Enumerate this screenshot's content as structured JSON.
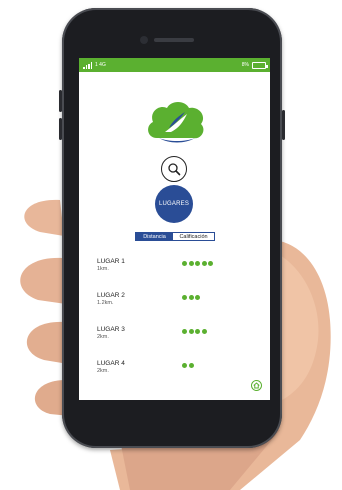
{
  "status_bar": {
    "network": "1 4G",
    "battery": "8%"
  },
  "home": {
    "places_button_label": "LUGARES"
  },
  "tabs": [
    {
      "label": "Distancia",
      "active": true
    },
    {
      "label": "Calificación",
      "active": false
    }
  ],
  "places": [
    {
      "name": "LUGAR 1",
      "distance": "1km.",
      "rating": 5
    },
    {
      "name": "LUGAR 2",
      "distance": "1.2km.",
      "rating": 3
    },
    {
      "name": "LUGAR 3",
      "distance": "2km.",
      "rating": 4
    },
    {
      "name": "LUGAR 4",
      "distance": "2km.",
      "rating": 2
    }
  ],
  "colors": {
    "accent_green": "#5bb030",
    "accent_blue": "#2a4d96"
  },
  "icons": {
    "search": "search-icon",
    "home": "home-icon",
    "logo": "cloud-bird-logo"
  }
}
